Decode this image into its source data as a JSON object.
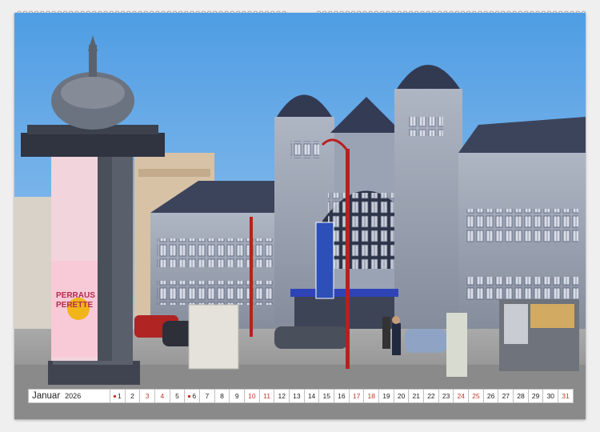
{
  "calendar": {
    "month": "Januar",
    "year": "2026",
    "days": [
      {
        "n": "1",
        "type": "holiday"
      },
      {
        "n": "2",
        "type": "weekday"
      },
      {
        "n": "3",
        "type": "sat"
      },
      {
        "n": "4",
        "type": "sun"
      },
      {
        "n": "5",
        "type": "weekday"
      },
      {
        "n": "6",
        "type": "holiday"
      },
      {
        "n": "7",
        "type": "weekday"
      },
      {
        "n": "8",
        "type": "weekday"
      },
      {
        "n": "9",
        "type": "weekday"
      },
      {
        "n": "10",
        "type": "sat"
      },
      {
        "n": "11",
        "type": "sun"
      },
      {
        "n": "12",
        "type": "weekday"
      },
      {
        "n": "13",
        "type": "weekday"
      },
      {
        "n": "14",
        "type": "weekday"
      },
      {
        "n": "15",
        "type": "weekday"
      },
      {
        "n": "16",
        "type": "weekday"
      },
      {
        "n": "17",
        "type": "sat"
      },
      {
        "n": "18",
        "type": "sun"
      },
      {
        "n": "19",
        "type": "weekday"
      },
      {
        "n": "20",
        "type": "weekday"
      },
      {
        "n": "21",
        "type": "weekday"
      },
      {
        "n": "22",
        "type": "weekday"
      },
      {
        "n": "23",
        "type": "weekday"
      },
      {
        "n": "24",
        "type": "sat"
      },
      {
        "n": "25",
        "type": "sun"
      },
      {
        "n": "26",
        "type": "weekday"
      },
      {
        "n": "27",
        "type": "weekday"
      },
      {
        "n": "28",
        "type": "weekday"
      },
      {
        "n": "29",
        "type": "weekday"
      },
      {
        "n": "30",
        "type": "weekday"
      },
      {
        "n": "31",
        "type": "sat"
      }
    ]
  },
  "photo": {
    "poster_lines": [
      "PERRAUS",
      "PERETTE"
    ],
    "colors": {
      "sky": "#5fa8e6",
      "building": "#8f9aaa",
      "roof": "#3a4158",
      "pavement": "#9a9a9a",
      "accent_red": "#c62828"
    }
  }
}
